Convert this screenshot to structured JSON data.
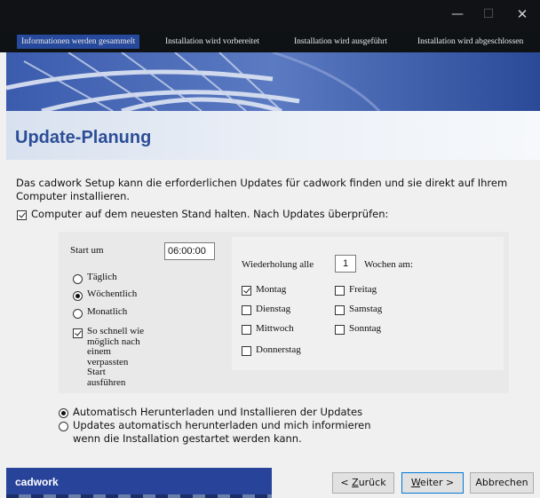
{
  "window": {
    "controls": {
      "minimize": "—",
      "maximize": "☐",
      "close": "✕"
    }
  },
  "steps": [
    {
      "label": "Informationen werden gesammelt",
      "active": true
    },
    {
      "label": "Installation wird vorbereitet",
      "active": false
    },
    {
      "label": "Installation wird ausgeführt",
      "active": false
    },
    {
      "label": "Installation wird abgeschlossen",
      "active": false
    }
  ],
  "page_title": "Update-Planung",
  "intro_text": "Das cadwork Setup kann die erforderlichen Updates für cadwork finden und sie direkt auf Ihrem Computer installieren.",
  "keep_updated": {
    "label": "Computer auf dem neuesten Stand halten. Nach Updates überprüfen:",
    "checked": true
  },
  "schedule": {
    "start_label": "Start um",
    "start_value": "06:00:00",
    "frequency": [
      {
        "label": "Täglich",
        "selected": false
      },
      {
        "label": "Wöchentlich",
        "selected": true
      },
      {
        "label": "Monatlich",
        "selected": false
      }
    ],
    "missed_start": {
      "lines": [
        "So schnell wie",
        "möglich nach",
        "einem",
        "verpassten",
        "Start",
        "ausführen"
      ],
      "checked": true
    },
    "repeat_label": "Wiederholung alle",
    "repeat_value": "1",
    "weeks_label": "Wochen am:",
    "days": [
      {
        "label": "Montag",
        "checked": true
      },
      {
        "label": "Dienstag",
        "checked": false
      },
      {
        "label": "Mittwoch",
        "checked": false
      },
      {
        "label": "Donnerstag",
        "checked": false
      },
      {
        "label": "Freitag",
        "checked": false
      },
      {
        "label": "Samstag",
        "checked": false
      },
      {
        "label": "Sonntag",
        "checked": false
      }
    ]
  },
  "update_mode": [
    {
      "label": "Automatisch Herunterladen und Installieren der Updates",
      "selected": true
    },
    {
      "label": "Updates automatisch herunterladen und mich informieren",
      "label2": "wenn die Installation gestartet werden kann.",
      "selected": false
    }
  ],
  "footer": {
    "brand": "cadwork",
    "back_prefix": "< ",
    "back_key": "Z",
    "back_rest": "urück",
    "next_key": "W",
    "next_rest": "eiter >",
    "cancel": "Abbrechen"
  },
  "colors": {
    "accent": "#27449a",
    "title": "#2c4d97",
    "titlebar": "#111215"
  }
}
